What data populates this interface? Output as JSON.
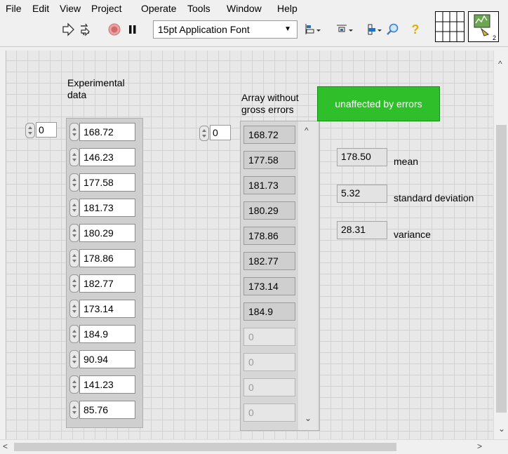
{
  "menu": [
    "File",
    "Edit",
    "View",
    "Project",
    "Operate",
    "Tools",
    "Window",
    "Help"
  ],
  "toolbar": {
    "run_icon": "run-arrow-icon",
    "run_continuous_icon": "run-continuously-icon",
    "abort_icon": "abort-stop-icon",
    "pause_icon": "pause-icon",
    "font": "15pt Application Font",
    "align_icon": "align-objects-icon",
    "distribute_icon": "distribute-objects-icon",
    "resize_icon": "resize-objects-icon",
    "search_icon": "search-icon",
    "help_icon": "context-help-icon"
  },
  "experimental": {
    "label": "Experimental\ndata",
    "index": "0",
    "values": [
      "168.72",
      "146.23",
      "177.58",
      "181.73",
      "180.29",
      "178.86",
      "182.77",
      "173.14",
      "184.9",
      "90.94",
      "141.23",
      "85.76"
    ]
  },
  "clean": {
    "label": "Array without\ngross errors",
    "index": "0",
    "values": [
      "168.72",
      "177.58",
      "181.73",
      "180.29",
      "178.86",
      "182.77",
      "173.14",
      "184.9",
      "0",
      "0",
      "0",
      "0"
    ]
  },
  "status": {
    "text": "unaffected by errors",
    "color": "#2fbf2a"
  },
  "stats": [
    {
      "value": "178.50",
      "label": "mean"
    },
    {
      "value": "5.32",
      "label": "standard deviation"
    },
    {
      "value": "28.31",
      "label": "variance"
    }
  ]
}
